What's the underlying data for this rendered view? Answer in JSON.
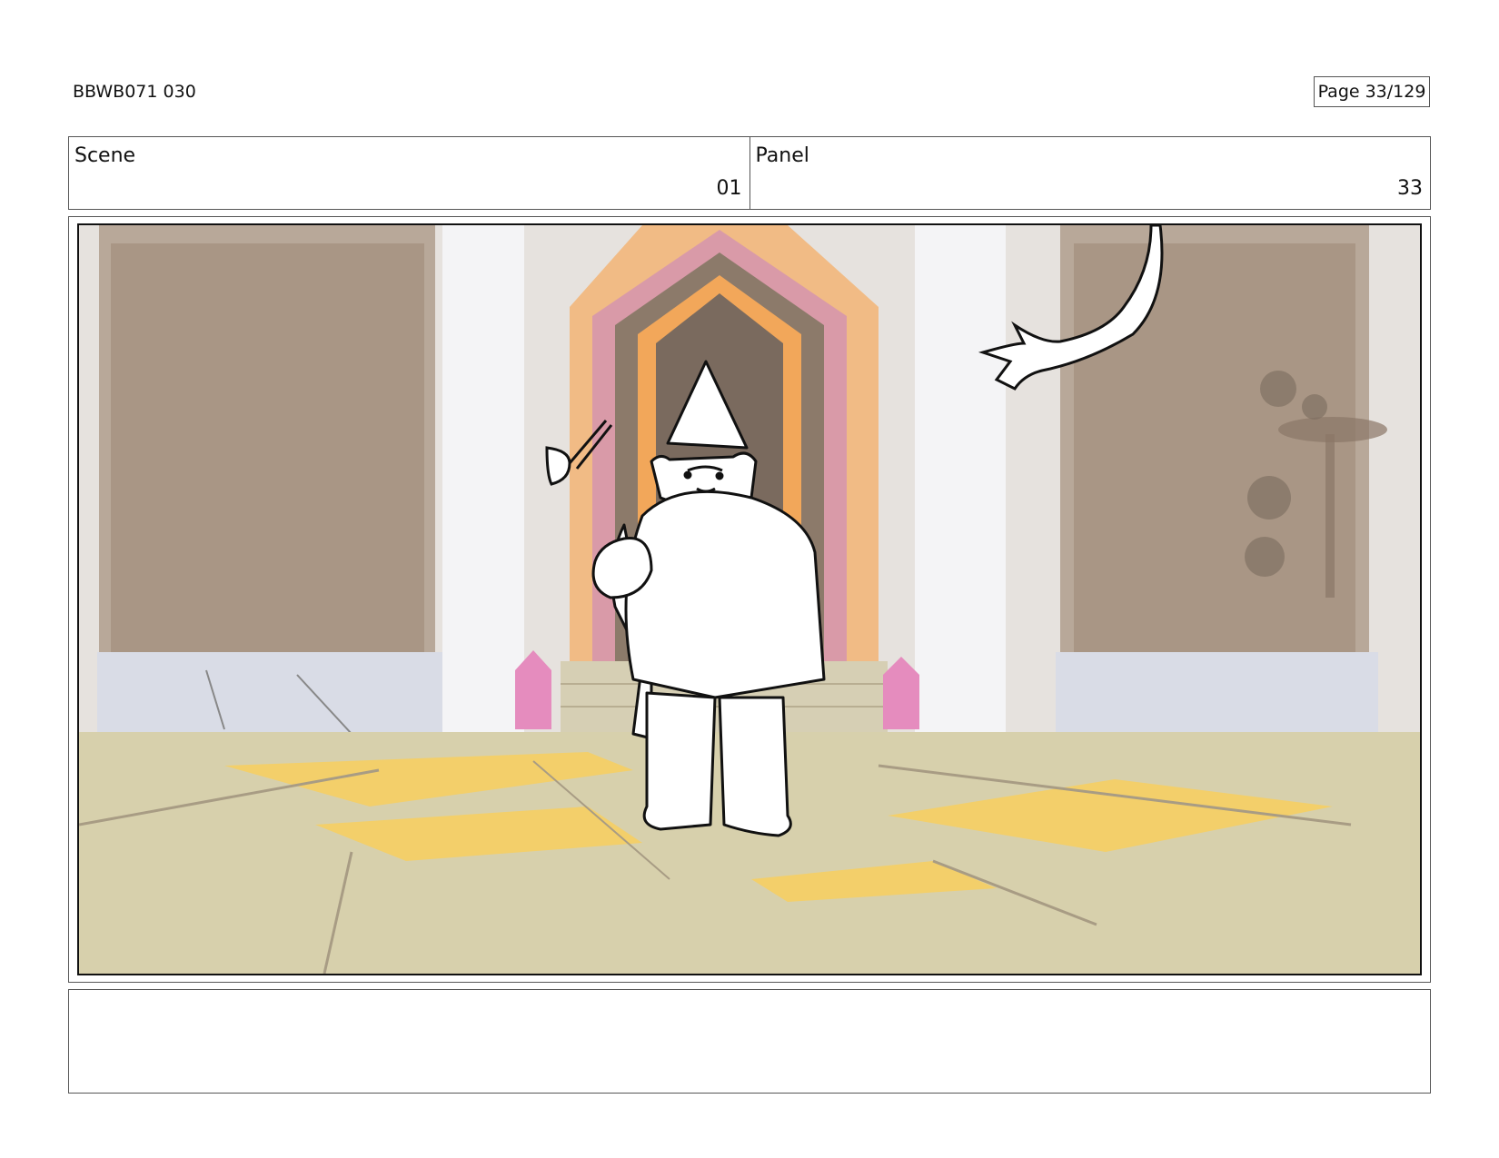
{
  "header": {
    "doc_id": "BBWB071 030",
    "page_label": "Page",
    "page_number": "33/129"
  },
  "info": {
    "scene_label": "Scene",
    "scene_value": "01",
    "panel_label": "Panel",
    "panel_value": "33"
  },
  "notes": {
    "text": ""
  }
}
